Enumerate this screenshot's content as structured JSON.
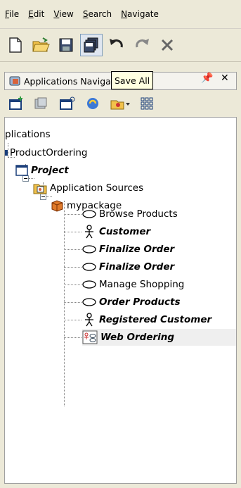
{
  "menubar": {
    "items": [
      {
        "mnemonic": "F",
        "rest": "ile"
      },
      {
        "mnemonic": "E",
        "rest": "dit"
      },
      {
        "mnemonic": "V",
        "rest": "iew"
      },
      {
        "mnemonic": "S",
        "rest": "earch"
      },
      {
        "mnemonic": "N",
        "rest": "avigate"
      }
    ]
  },
  "toolbar": {
    "buttons": [
      "new-file-icon",
      "open-folder-icon",
      "save-icon",
      "save-all-icon",
      "undo-icon",
      "redo-icon",
      "cut-icon"
    ]
  },
  "panel": {
    "title": "Applications Navigator",
    "tooltip": "Save All"
  },
  "tree": {
    "root": "plications",
    "app": "ProductOrdering",
    "project": "Project",
    "sources": "Application Sources",
    "package": "mypackage",
    "items": [
      {
        "label": "Browse Products",
        "icon": "use-case-icon",
        "style": "plain"
      },
      {
        "label": "Customer",
        "icon": "actor-icon",
        "style": "bold-italic"
      },
      {
        "label": "Finalize Order",
        "icon": "use-case-icon",
        "style": "bold-italic"
      },
      {
        "label": "Finalize Order",
        "icon": "use-case-icon",
        "style": "bold-italic"
      },
      {
        "label": "Manage Shopping",
        "icon": "use-case-icon",
        "style": "plain"
      },
      {
        "label": "Order Products",
        "icon": "use-case-icon",
        "style": "bold-italic"
      },
      {
        "label": "Registered Customer",
        "icon": "actor-icon",
        "style": "bold-italic"
      },
      {
        "label": "Web Ordering",
        "icon": "use-case-diagram-icon",
        "style": "bold-italic"
      }
    ]
  }
}
